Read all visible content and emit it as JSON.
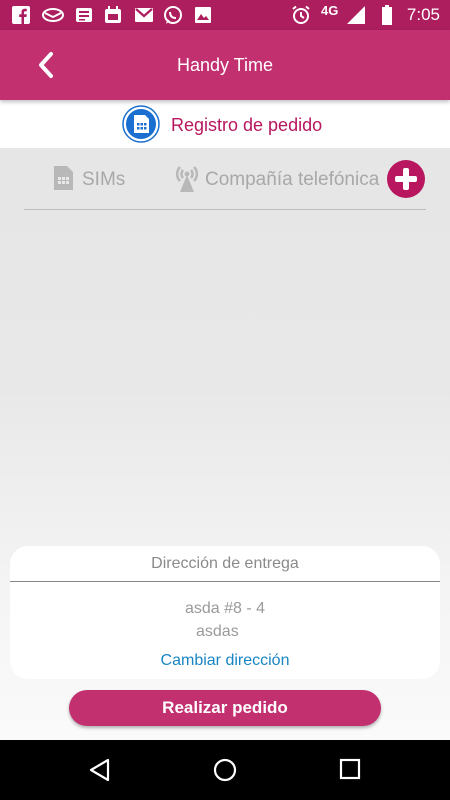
{
  "status_bar": {
    "icons": [
      "facebook-icon",
      "mail-app-icon",
      "news-icon",
      "calendar-icon",
      "gmail-icon",
      "whatsapp-icon",
      "image-icon",
      "alarm-icon",
      "signal-icon",
      "battery-icon"
    ],
    "network": "4G",
    "time": "7:05"
  },
  "app_bar": {
    "title": "Handy Time",
    "back_icon": "chevron-left-icon"
  },
  "section": {
    "label": "Registro de pedido",
    "icon": "order-icon"
  },
  "tabs": {
    "sims_label": "SIMs",
    "company_label": "Compañía telefónica",
    "add_icon": "plus-icon"
  },
  "delivery": {
    "title": "Dirección de entrega",
    "address_line1": "asda #8 - 4",
    "address_line2": "asdas",
    "change_label": "Cambiar dirección"
  },
  "submit": {
    "label": "Realizar pedido"
  },
  "colors": {
    "primary": "#c3306f",
    "status_bar": "#ad1e5e",
    "accent_text": "#b8165e",
    "link": "#1a85c4"
  }
}
